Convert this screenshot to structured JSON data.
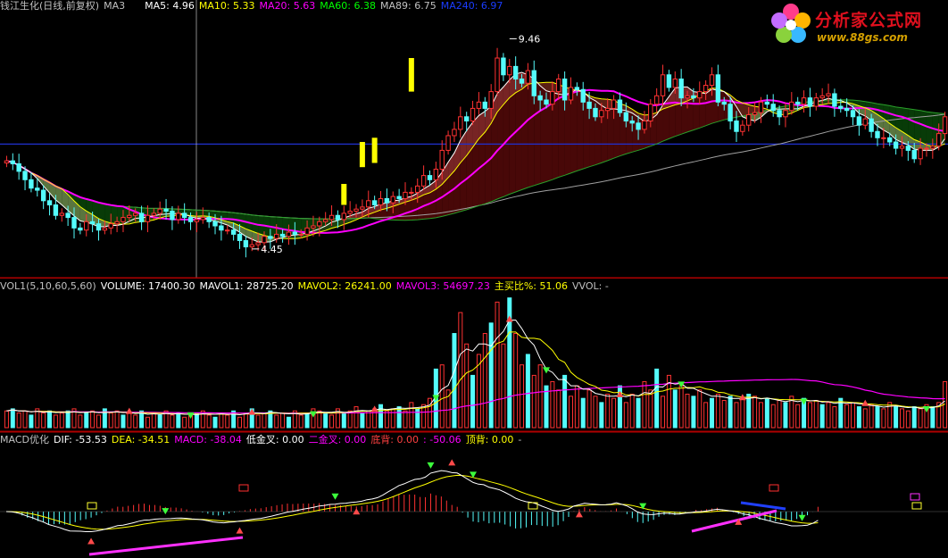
{
  "logo": {
    "title": "分析家公式网",
    "url": "www.88gs.com"
  },
  "price_header": {
    "name": "钱江生化(日线,前复权)",
    "ind": "MA3",
    "items": [
      {
        "label": "MA5: 4.96",
        "color": "#ffffff"
      },
      {
        "label": "MA10: 5.33",
        "color": "#ffff00"
      },
      {
        "label": "MA20: 5.63",
        "color": "#ff00ff"
      },
      {
        "label": "MA60: 6.38",
        "color": "#00ff00"
      },
      {
        "label": "MA89: 6.75",
        "color": "#c0c0c0"
      },
      {
        "label": "MA240: 6.97",
        "color": "#1a3cff"
      }
    ]
  },
  "vol_header": {
    "items": [
      {
        "label": "VOL1(5,10,60,5,60)",
        "color": "#c0c0c0"
      },
      {
        "label": "VOLUME: 17400.30",
        "color": "#ffffff"
      },
      {
        "label": "MAVOL1: 28725.20",
        "color": "#ffffff"
      },
      {
        "label": "MAVOL2: 26241.00",
        "color": "#ffff00"
      },
      {
        "label": "MAVOL3: 54697.23",
        "color": "#ff00ff"
      },
      {
        "label": "主买比%: 51.06",
        "color": "#ffff00"
      },
      {
        "label": "VVOL: -",
        "color": "#c0c0c0"
      }
    ]
  },
  "macd_header": {
    "items": [
      {
        "label": "MACD优化",
        "color": "#c0c0c0"
      },
      {
        "label": "DIF: -53.53",
        "color": "#ffffff"
      },
      {
        "label": "DEA: -34.51",
        "color": "#ffff00"
      },
      {
        "label": "MACD: -38.04",
        "color": "#ff00ff"
      },
      {
        "label": "低金叉: 0.00",
        "color": "#ffffff"
      },
      {
        "label": "二金叉: 0.00",
        "color": "#ff00ff"
      },
      {
        "label": "底背: 0.00",
        "color": "#ff4040"
      },
      {
        "label": ": -50.06",
        "color": "#ff00ff"
      },
      {
        "label": "顶背: 0.00",
        "color": "#ffff00"
      },
      {
        "label": "-",
        "color": "#c0c0c0"
      }
    ]
  },
  "colors": {
    "up": "#ff3232",
    "down": "#54fcfc",
    "bg": "#000000",
    "separator": "#b00000"
  },
  "chart_data": [
    {
      "type": "candlestick",
      "panel": "price",
      "ylim": [
        4.0,
        10.0
      ],
      "annotations": [
        {
          "label": "9.46",
          "index": 82,
          "value": 9.46
        },
        {
          "label": "4.45",
          "index": 40,
          "value": 4.45
        }
      ],
      "reference_line": 6.95,
      "open": [
        6.5,
        6.55,
        6.48,
        6.3,
        6.1,
        5.9,
        5.85,
        5.6,
        5.5,
        5.25,
        5.3,
        5.2,
        4.95,
        4.9,
        5.1,
        5.05,
        4.9,
        4.95,
        5.05,
        5.1,
        5.2,
        5.25,
        5.3,
        5.1,
        5.25,
        5.3,
        5.4,
        5.35,
        5.15,
        5.3,
        5.2,
        5.1,
        5.15,
        5.2,
        5.1,
        5.0,
        4.9,
        4.9,
        4.8,
        4.65,
        4.5,
        4.55,
        4.6,
        4.75,
        4.7,
        4.8,
        4.75,
        4.85,
        4.8,
        4.8,
        4.95,
        5.0,
        5.1,
        5.15,
        5.25,
        5.15,
        5.3,
        5.35,
        5.4,
        5.45,
        5.6,
        5.5,
        5.65,
        5.55,
        5.7,
        5.65,
        5.8,
        5.8,
        5.95,
        6.2,
        6.1,
        6.35,
        6.8,
        7.15,
        7.3,
        7.6,
        7.5,
        7.8,
        7.95,
        7.8,
        8.2,
        9.0,
        8.6,
        8.8,
        8.5,
        8.4,
        8.7,
        8.1,
        8.0,
        7.9,
        8.2,
        8.5,
        8.0,
        8.3,
        8.25,
        7.95,
        7.8,
        7.6,
        7.75,
        7.8,
        8.0,
        7.7,
        7.5,
        7.45,
        7.3,
        7.5,
        7.9,
        8.1,
        8.6,
        8.3,
        8.5,
        8.05,
        8.1,
        8.05,
        8.2,
        8.35,
        8.6,
        7.95,
        7.9,
        7.5,
        7.25,
        7.4,
        7.65,
        7.7,
        7.95,
        7.9,
        7.75,
        7.6,
        7.75,
        7.95,
        7.9,
        8.05,
        7.85,
        8.05,
        8.1,
        8.15,
        7.85,
        7.8,
        7.75,
        7.6,
        7.4,
        7.55,
        7.25,
        7.1,
        7.1,
        7.0,
        6.85,
        6.9,
        6.8,
        6.6,
        6.85,
        6.85,
        6.9,
        7.2
      ],
      "close": [
        6.55,
        6.48,
        6.3,
        6.1,
        5.9,
        5.85,
        5.6,
        5.5,
        5.25,
        5.3,
        5.2,
        4.95,
        4.9,
        5.1,
        5.05,
        4.9,
        4.95,
        5.05,
        5.1,
        5.2,
        5.25,
        5.3,
        5.1,
        5.25,
        5.3,
        5.4,
        5.35,
        5.15,
        5.3,
        5.2,
        5.1,
        5.15,
        5.2,
        5.1,
        5.0,
        4.9,
        4.9,
        4.8,
        4.65,
        4.5,
        4.55,
        4.6,
        4.75,
        4.7,
        4.8,
        4.75,
        4.85,
        4.8,
        4.8,
        4.95,
        5.0,
        5.1,
        5.15,
        5.25,
        5.15,
        5.3,
        5.35,
        5.4,
        5.45,
        5.6,
        5.5,
        5.65,
        5.55,
        5.7,
        5.65,
        5.8,
        5.8,
        5.95,
        6.2,
        6.1,
        6.35,
        6.8,
        7.15,
        7.3,
        7.6,
        7.5,
        7.8,
        7.95,
        7.8,
        8.2,
        9.0,
        8.6,
        8.8,
        8.5,
        8.4,
        8.7,
        8.1,
        8.0,
        7.9,
        8.2,
        8.5,
        8.0,
        8.3,
        8.25,
        7.95,
        7.8,
        7.6,
        7.75,
        7.8,
        8.0,
        7.7,
        7.5,
        7.45,
        7.3,
        7.5,
        7.9,
        8.1,
        8.6,
        8.3,
        8.5,
        8.05,
        8.1,
        8.05,
        8.2,
        8.35,
        8.6,
        7.95,
        7.9,
        7.5,
        7.25,
        7.4,
        7.65,
        7.7,
        7.95,
        7.9,
        7.75,
        7.6,
        7.75,
        7.95,
        7.9,
        8.05,
        7.85,
        8.05,
        8.1,
        8.15,
        7.85,
        7.8,
        7.75,
        7.6,
        7.4,
        7.55,
        7.25,
        7.1,
        7.1,
        7.0,
        6.85,
        6.9,
        6.8,
        6.6,
        6.85,
        6.85,
        6.9,
        7.2,
        7.6
      ]
    },
    {
      "type": "bar",
      "panel": "volume",
      "values": [
        8,
        9,
        7,
        8,
        6,
        9,
        7,
        8,
        6,
        7,
        8,
        9,
        6,
        7,
        8,
        6,
        9,
        7,
        8,
        6,
        7,
        6,
        8,
        5,
        7,
        6,
        8,
        6,
        7,
        5,
        6,
        7,
        8,
        6,
        5,
        7,
        6,
        8,
        5,
        7,
        9,
        6,
        7,
        8,
        6,
        7,
        5,
        8,
        6,
        7,
        9,
        8,
        7,
        6,
        9,
        7,
        8,
        10,
        7,
        8,
        9,
        11,
        8,
        9,
        10,
        8,
        12,
        9,
        11,
        14,
        28,
        30,
        18,
        45,
        55,
        40,
        25,
        35,
        45,
        50,
        60,
        40,
        62,
        45,
        30,
        35,
        25,
        30,
        20,
        22,
        18,
        25,
        15,
        20,
        14,
        18,
        15,
        12,
        16,
        14,
        20,
        12,
        16,
        14,
        22,
        18,
        28,
        15,
        25,
        18,
        20,
        16,
        15,
        18,
        12,
        14,
        16,
        13,
        15,
        12,
        14,
        16,
        15,
        12,
        14,
        11,
        13,
        12,
        15,
        11,
        14,
        12,
        13,
        11,
        12,
        10,
        14,
        11,
        12,
        10,
        9,
        11,
        10,
        9,
        12,
        10,
        9,
        8,
        10,
        9,
        11,
        10,
        12,
        22
      ]
    },
    {
      "type": "line",
      "panel": "macd",
      "ylim": [
        -1,
        1
      ],
      "note": "DIF/DEA lines and MACD histogram"
    }
  ]
}
